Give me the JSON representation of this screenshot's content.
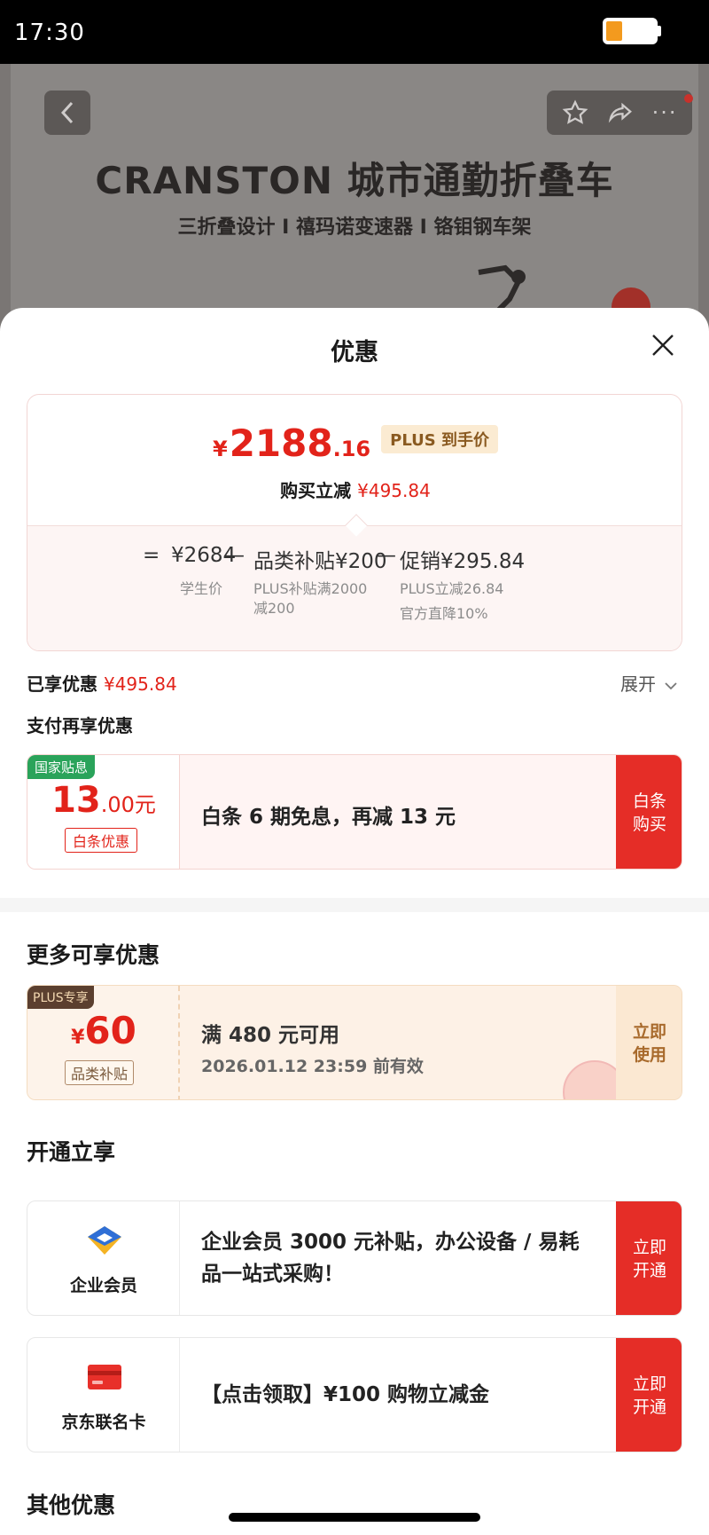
{
  "status_bar": {
    "time": "17:30"
  },
  "product": {
    "title": "CRANSTON 城市通勤折叠车",
    "subtitle": "三折叠设计 I 禧玛诺变速器 I 铬钼钢车架"
  },
  "sheet": {
    "title": "优惠",
    "price": {
      "yen": "¥",
      "integer": "2188",
      "decimal": ".16",
      "tag": "PLUS 到手价",
      "instant_off_label": "购买立减",
      "instant_off_value": "¥495.84"
    },
    "formula": {
      "eq": "=",
      "base_price": "¥2684",
      "base_label": "学生价",
      "minus1": "—",
      "category_subsidy": "品类补贴¥200",
      "category_note_1": "PLUS补贴满2000",
      "category_note_2": "减200",
      "minus2": "—",
      "promo": "促销¥295.84",
      "promo_note_1": "PLUS立减26.84",
      "promo_note_2": "官方直降10%"
    },
    "applied_label": "已享优惠",
    "applied_value": "¥495.84",
    "expand_label": "展开",
    "pay_more_label": "支付再享优惠",
    "baitiao": {
      "tag": "国家贴息",
      "amount_int": "13",
      "amount_dec": ".00元",
      "chip": "白条优惠",
      "text": "白条 6 期免息，再减 13 元",
      "button_line1": "白条",
      "button_line2": "购买"
    },
    "more_title": "更多可享优惠",
    "coupon": {
      "tag": "PLUS专享",
      "yen": "¥",
      "amount": "60",
      "chip": "品类补贴",
      "line1": "满 480 元可用",
      "line2": "2026.01.12 23:59 前有效",
      "button_line1": "立即",
      "button_line2": "使用"
    },
    "open_title": "开通立享",
    "memberships": [
      {
        "label": "企业会员",
        "text": "企业会员 3000 元补贴，办公设备 / 易耗品一站式采购！",
        "button_line1": "立即",
        "button_line2": "开通"
      },
      {
        "label": "京东联名卡",
        "text": "【点击领取】¥100 购物立减金",
        "button_line1": "立即",
        "button_line2": "开通"
      }
    ],
    "other_title": "其他优惠"
  },
  "colors": {
    "accent_red": "#e2231a",
    "button_red": "#e52d27",
    "gov_green": "#2aa35a",
    "plus_brown": "#5b3f2f"
  },
  "icons": [
    "back-icon",
    "star-icon",
    "share-icon",
    "more-icon",
    "close-icon",
    "chevron-down-icon",
    "enterprise-member-icon",
    "card-icon"
  ]
}
